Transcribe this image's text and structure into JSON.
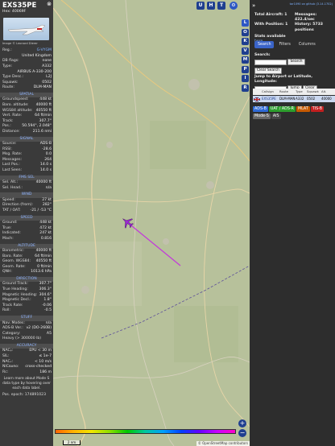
{
  "aircraft": {
    "callsign": "EXS35PE",
    "hex_label": "Hex: 40069F",
    "image_credit": "Image © Leonard Dierer"
  },
  "info_rows": [
    {
      "k": "Reg.:",
      "v": "G-VYGM",
      "link": true
    },
    {
      "k": "",
      "v": "United Kingdom",
      "link": false
    },
    {
      "k": "DB flags:",
      "v": "none",
      "link": false
    },
    {
      "k": "Type:",
      "v": "A332",
      "link": false
    },
    {
      "k": "",
      "v": "AIRBUS A-330-200",
      "link": false
    },
    {
      "k": "Type Desc.:",
      "v": "L2J",
      "link": false
    },
    {
      "k": "Squawk:",
      "v": "0502",
      "link": false
    },
    {
      "k": "Route:",
      "v": "DLM-MAN",
      "link": false
    }
  ],
  "sections": [
    {
      "title": "SPATIAL",
      "rows": [
        {
          "k": "Groundspeed:",
          "v": "448 kt"
        },
        {
          "k": "Baro. altitude:",
          "v": "40000 ft"
        },
        {
          "k": "WGS84 altitude:",
          "v": "40550 ft"
        },
        {
          "k": "Vert. Rate:",
          "v": "64 ft/min"
        },
        {
          "k": "Track:",
          "v": "307.7°"
        },
        {
          "k": "Pos.:",
          "v": "50.594°, 2.048°"
        },
        {
          "k": "Distance:",
          "v": "211.6 nmi"
        }
      ]
    },
    {
      "title": "SIGNAL",
      "rows": [
        {
          "k": "Source:",
          "v": "ADS-B"
        },
        {
          "k": "RSSI:",
          "v": "-28.6"
        },
        {
          "k": "Msg. Rate:",
          "v": "0.0"
        },
        {
          "k": "Messages:",
          "v": "264"
        },
        {
          "k": "Last Pos.:",
          "v": "14.0 s"
        },
        {
          "k": "Last Seen:",
          "v": "14.0 s"
        }
      ]
    },
    {
      "title": "FMS SEL",
      "rows": [
        {
          "k": "Sel. Alt.:",
          "v": "40000 ft"
        },
        {
          "k": "Sel. Head.:",
          "v": "n/a"
        }
      ]
    },
    {
      "title": "WIND",
      "rows": [
        {
          "k": "Speed:",
          "v": "27 kt"
        },
        {
          "k": "Direction (from):",
          "v": "282°"
        },
        {
          "k": "TAT / OAT:",
          "v": "-21 / -53 °C"
        }
      ]
    },
    {
      "title": "SPEED",
      "rows": [
        {
          "k": "Ground:",
          "v": "448 kt"
        },
        {
          "k": "True:",
          "v": "472 kt"
        },
        {
          "k": "Indicated:",
          "v": "247 kt"
        },
        {
          "k": "Mach:",
          "v": "0.816"
        }
      ]
    },
    {
      "title": "ALTITUDE",
      "rows": [
        {
          "k": "Barometric:",
          "v": "40000 ft"
        },
        {
          "k": "Baro. Rate:",
          "v": "64 ft/min"
        },
        {
          "k": "Geom. WGS84:",
          "v": "40550 ft"
        },
        {
          "k": "Geom. Rate:",
          "v": "0 ft/min"
        },
        {
          "k": "QNH:",
          "v": "1013.6 hPa"
        }
      ]
    },
    {
      "title": "DIRECTION",
      "rows": [
        {
          "k": "Ground Track:",
          "v": "307.7°"
        },
        {
          "k": "True Heading:",
          "v": "306.3°"
        },
        {
          "k": "Magnetic Heading:",
          "v": "304.6°"
        },
        {
          "k": "Magnetic Decl.:",
          "v": "1.8°"
        },
        {
          "k": "Track Rate:",
          "v": "-0.06"
        },
        {
          "k": "Roll:",
          "v": "-0.5"
        }
      ]
    },
    {
      "title": "STUFF",
      "rows": [
        {
          "k": "Nav. Modes:",
          "v": "n/a"
        },
        {
          "k": "ADS-B Ver.:",
          "v": "v2 (DO-260B)"
        },
        {
          "k": "Category:",
          "v": "A5"
        },
        {
          "k": "Heavy (> 300000 lb)",
          "v": ""
        }
      ]
    },
    {
      "title": "ACCURACY",
      "rows": [
        {
          "k": "NACₚ:",
          "v": "EPU < 30 m"
        },
        {
          "k": "SIL:",
          "v": "≤ 1e-7"
        },
        {
          "k": "NACᵥ:",
          "v": "< 10 m/s"
        },
        {
          "k": "NICʙᴀʀᴏ:",
          "v": "cross-checked"
        },
        {
          "k": "Rᴄ:",
          "v": "186 m"
        }
      ]
    }
  ],
  "learn_text": "Learn more about Mode S data type by hovering over each data label.",
  "pos_epoch": "Pos. epoch: 174891023",
  "map": {
    "buttons": [
      "U",
      "H",
      "T"
    ],
    "scale_label": "2 nm",
    "attribution": "© OpenStreetMap contributors",
    "zoom_in": "+",
    "zoom_out": "−",
    "altitude_ticks": [
      "",
      "",
      "",
      "",
      "",
      "",
      "",
      "",
      "",
      "",
      ""
    ]
  },
  "rail": [
    "L",
    "O",
    "K",
    "V",
    "M",
    "P",
    "I",
    "R"
  ],
  "right": {
    "nav_arrow": "»",
    "github_link": "tar1090 on github (3.14.1702)",
    "stats": {
      "total_label": "Total Aircraft: 1",
      "messages_label": "Messages:",
      "messages_value": "422.4/sec",
      "with_pos_label": "With Position: 1",
      "history_label": "History: 5733 positions",
      "stats_available": "Stats available",
      "here": "here"
    },
    "tabs": [
      "Search",
      "Filters",
      "Columns"
    ],
    "search_label": "Search:",
    "search_button": "Search",
    "clear_search": "Clear Search",
    "jump_label": "Jump to Airport or Latitude, Longitude:",
    "jump_button": "Jump",
    "clear_button": "Clear",
    "columns": [
      "",
      "Callsign",
      "Route",
      "Type",
      "Squawk",
      "Alt."
    ],
    "row": {
      "flag": "",
      "callsign": "EXS35PE",
      "route": "DLM-MAN",
      "type": "A332",
      "squawk": "0502",
      "alt": "40000"
    },
    "badges": [
      {
        "label": "ADS-B",
        "color": "#2f6ad6"
      },
      {
        "label": "UAT / ADS-R",
        "color": "#2d9e2d"
      },
      {
        "label": "MLAT",
        "color": "#c75a00"
      },
      {
        "label": "TIS-B",
        "color": "#c21f1f"
      },
      {
        "label": "Mode-S",
        "color": "#666"
      },
      {
        "label": "AIS",
        "color": "#444"
      }
    ]
  },
  "colors": {
    "accent": "#1f3f8f",
    "section_text": "#8fb4ff",
    "track": "#c23cd8"
  }
}
